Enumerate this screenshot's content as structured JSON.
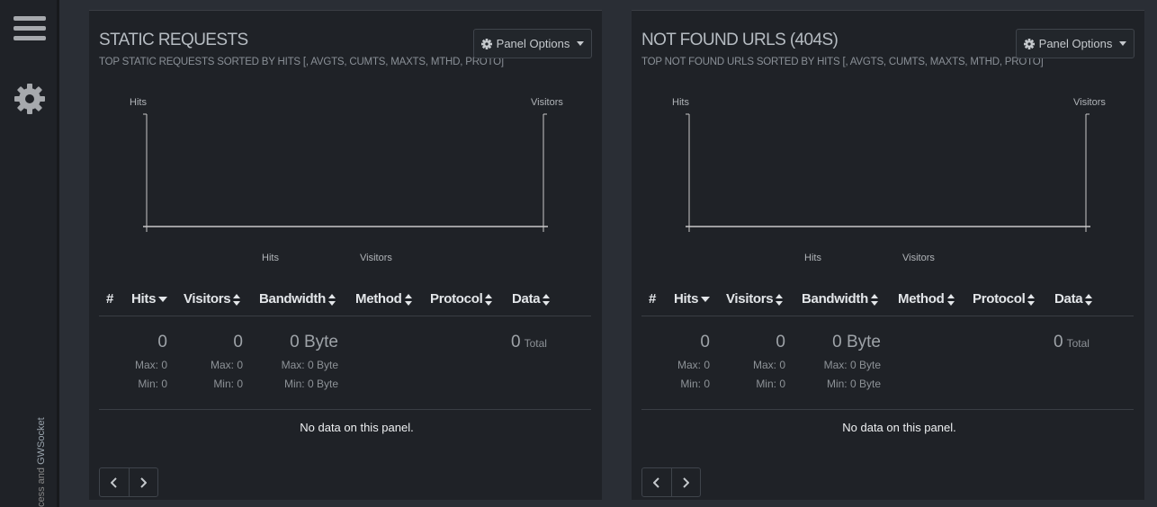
{
  "sidebar": {
    "footer_text_pre": "cess and ",
    "footer_link": "GWSocket"
  },
  "panels": [
    {
      "title": "STATIC REQUESTS",
      "subtitle": "TOP STATIC REQUESTS SORTED BY HITS [, AVGTS, CUMTS, MAXTS, MTHD, PROTO]",
      "options_label": "Panel Options",
      "chart": {
        "y_left_label": "Hits",
        "y_right_label": "Visitors",
        "legend": [
          "Hits",
          "Visitors"
        ]
      },
      "columns": [
        "#",
        "Hits",
        "Visitors",
        "Bandwidth",
        "Method",
        "Protocol",
        "Data"
      ],
      "summary": {
        "hits": "0",
        "hits_max": "Max: 0",
        "hits_min": "Min: 0",
        "visitors": "0",
        "visitors_max": "Max: 0",
        "visitors_min": "Min: 0",
        "bandwidth": "0 Byte",
        "bandwidth_max": "Max: 0 Byte",
        "bandwidth_min": "Min: 0 Byte",
        "data": "0",
        "data_label": "Total"
      },
      "no_data": "No data on this panel."
    },
    {
      "title": "NOT FOUND URLS (404S)",
      "subtitle": "TOP NOT FOUND URLS SORTED BY HITS [, AVGTS, CUMTS, MAXTS, MTHD, PROTO]",
      "options_label": "Panel Options",
      "chart": {
        "y_left_label": "Hits",
        "y_right_label": "Visitors",
        "legend": [
          "Hits",
          "Visitors"
        ]
      },
      "columns": [
        "#",
        "Hits",
        "Visitors",
        "Bandwidth",
        "Method",
        "Protocol",
        "Data"
      ],
      "summary": {
        "hits": "0",
        "hits_max": "Max: 0",
        "hits_min": "Min: 0",
        "visitors": "0",
        "visitors_max": "Max: 0",
        "visitors_min": "Min: 0",
        "bandwidth": "0 Byte",
        "bandwidth_max": "Max: 0 Byte",
        "bandwidth_min": "Min: 0 Byte",
        "data": "0",
        "data_label": "Total"
      },
      "no_data": "No data on this panel."
    }
  ]
}
